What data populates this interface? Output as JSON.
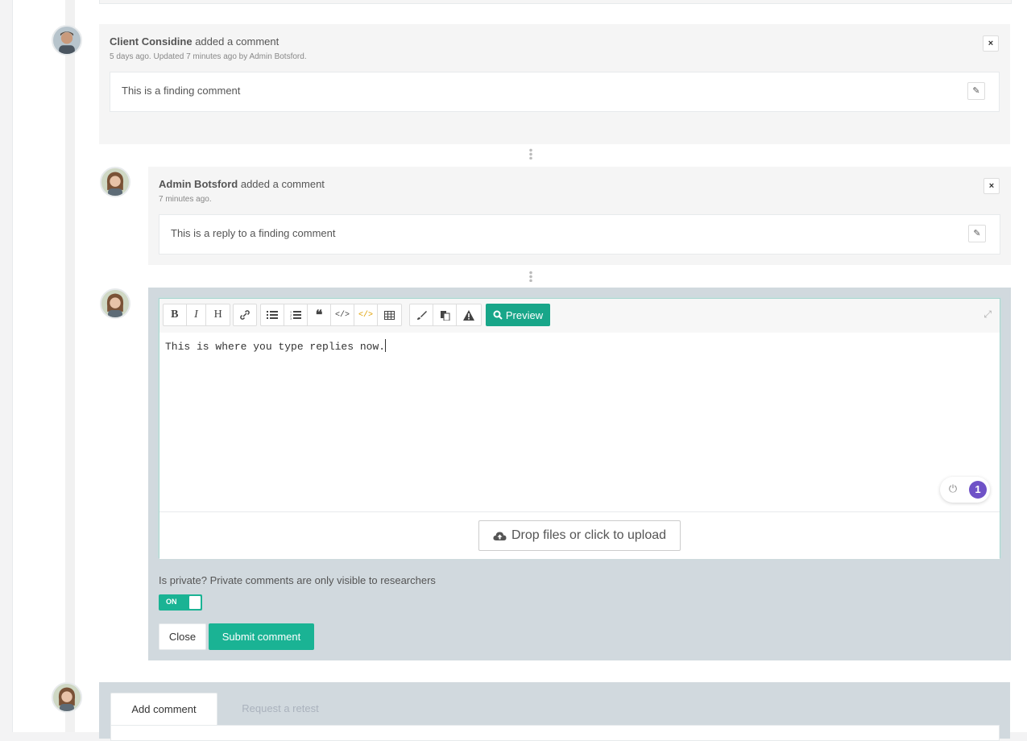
{
  "comments": [
    {
      "author": "Client Considine",
      "action": "added a comment",
      "meta": "5 days ago. Updated 7 minutes ago by Admin Botsford.",
      "body": "This is a finding comment"
    },
    {
      "author": "Admin Botsford",
      "action": "added a comment",
      "meta": "7 minutes ago.",
      "body": "This is a reply to a finding comment"
    }
  ],
  "icons": {
    "close": "×",
    "edit": "✎",
    "expand": "⤢",
    "power": "⏻",
    "upload": "☁",
    "search": "🔍"
  },
  "editor": {
    "toolbar_buttons": [
      "B",
      "I",
      "H",
      "link",
      "bulleted-list",
      "numbered-list",
      "quote",
      "code",
      "code-block",
      "table",
      "brush",
      "paste",
      "warning"
    ],
    "preview_label": "Preview",
    "text": "This is where you type replies now.",
    "upload_label": "Drop files or click to upload",
    "widget_count": "1"
  },
  "reply_form": {
    "private_label": "Is private? Private comments are only visible to researchers",
    "toggle_label": "ON",
    "close_label": "Close",
    "submit_label": "Submit comment"
  },
  "tabs": [
    {
      "label": "Add comment",
      "active": true
    },
    {
      "label": "Request a retest",
      "active": false
    }
  ],
  "colors": {
    "accent": "#1ab394",
    "preview": "#18a689",
    "panel": "#d1d9de",
    "badge": "#6f52c7"
  }
}
